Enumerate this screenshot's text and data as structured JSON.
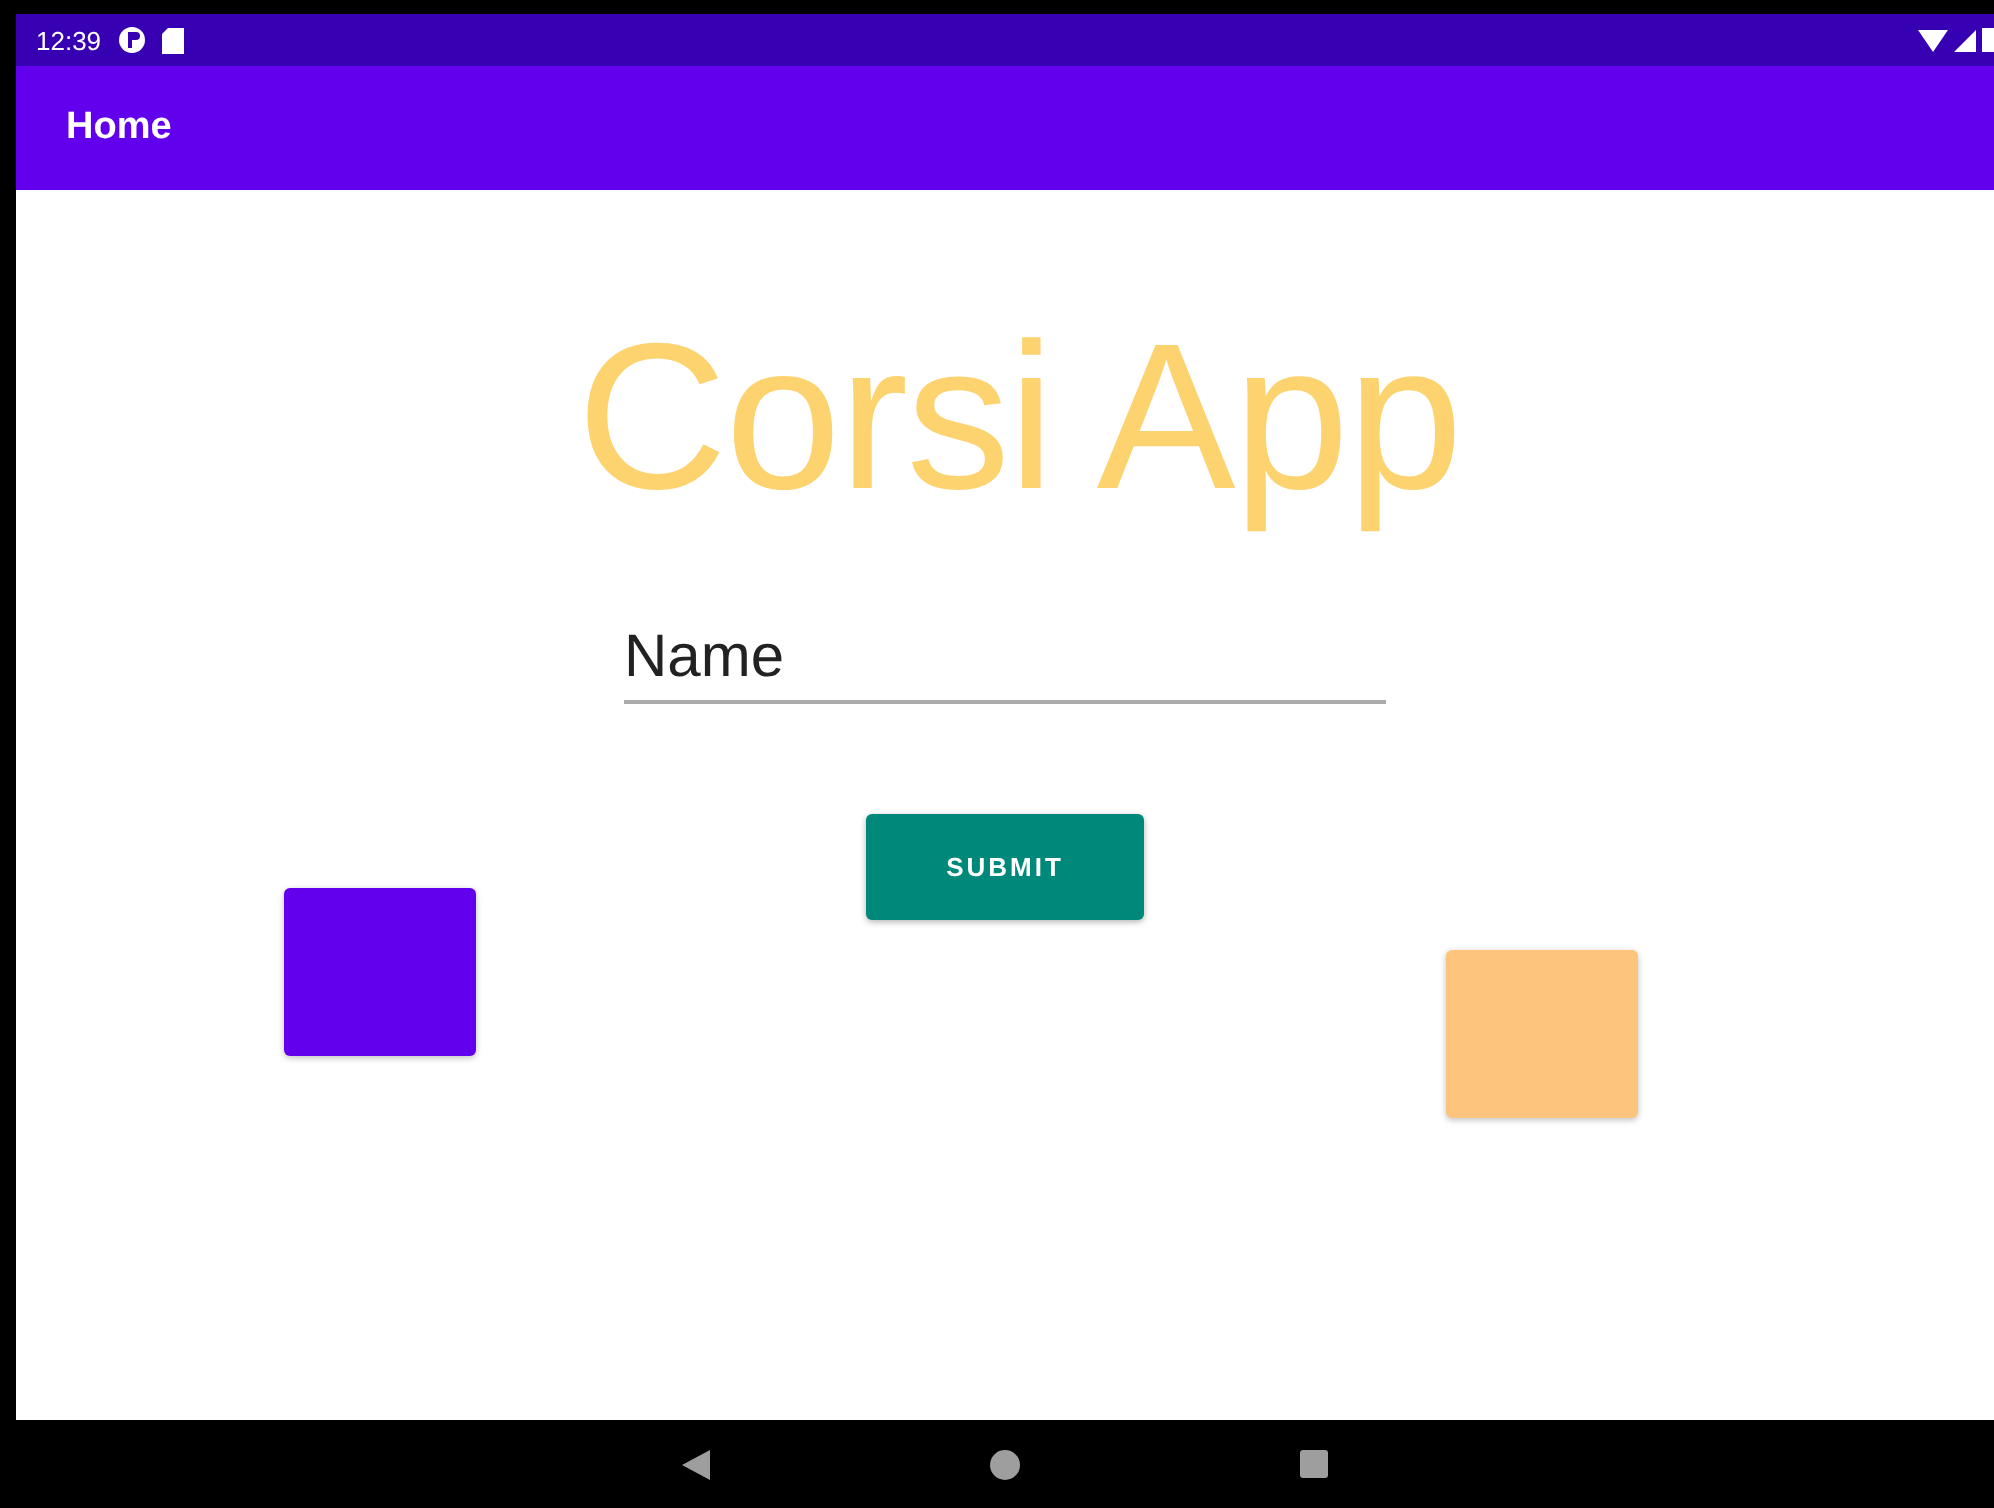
{
  "status_bar": {
    "time": "12:39"
  },
  "app_bar": {
    "title": "Home"
  },
  "title": "Corsi App",
  "name_field": {
    "value": "Name"
  },
  "submit_button": {
    "label": "SUBMIT"
  },
  "blocks": [
    {
      "color": "#6200ee"
    },
    {
      "color": "#fcc47c"
    }
  ]
}
